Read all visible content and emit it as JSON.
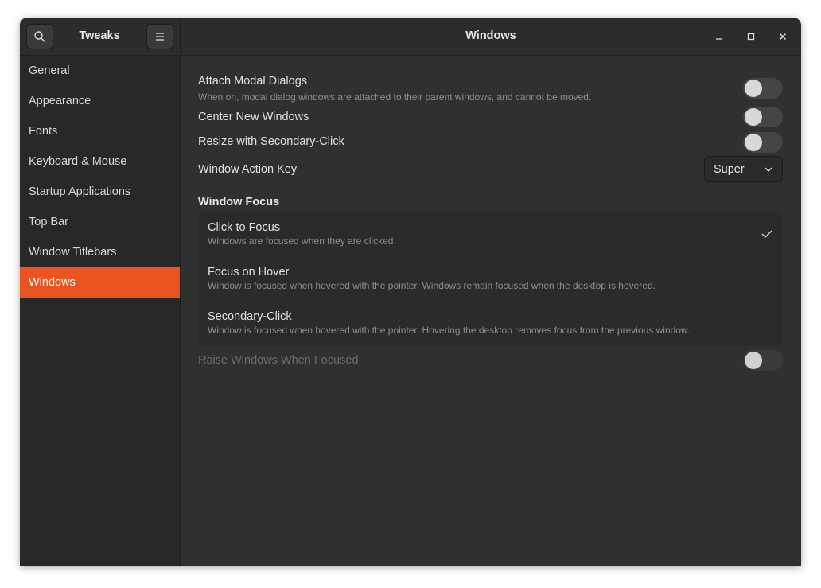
{
  "sidebar": {
    "title": "Tweaks",
    "search_icon": "search-icon",
    "menu_icon": "hamburger-menu-icon",
    "items": [
      {
        "label": "General",
        "active": false
      },
      {
        "label": "Appearance",
        "active": false
      },
      {
        "label": "Fonts",
        "active": false
      },
      {
        "label": "Keyboard & Mouse",
        "active": false
      },
      {
        "label": "Startup Applications",
        "active": false
      },
      {
        "label": "Top Bar",
        "active": false
      },
      {
        "label": "Window Titlebars",
        "active": false
      },
      {
        "label": "Windows",
        "active": true
      }
    ]
  },
  "header": {
    "title": "Windows",
    "controls": [
      "minimize-icon",
      "maximize-icon",
      "close-icon"
    ]
  },
  "settings": {
    "attach_modal": {
      "label": "Attach Modal Dialogs",
      "description": "When on, modal dialog windows are attached to their parent windows, and cannot be moved.",
      "enabled": false
    },
    "center_new": {
      "label": "Center New Windows",
      "enabled": false
    },
    "resize_secondary": {
      "label": "Resize with Secondary-Click",
      "enabled": false
    },
    "action_key": {
      "label": "Window Action Key",
      "value": "Super"
    }
  },
  "window_focus": {
    "title": "Window Focus",
    "options": [
      {
        "title": "Click to Focus",
        "description": "Windows are focused when they are clicked.",
        "selected": true
      },
      {
        "title": "Focus on Hover",
        "description": "Window is focused when hovered with the pointer. Windows remain focused when the desktop is hovered.",
        "selected": false
      },
      {
        "title": "Secondary-Click",
        "description": "Window is focused when hovered with the pointer. Hovering the desktop removes focus from the previous window.",
        "selected": false
      }
    ],
    "raise": {
      "label": "Raise Windows When Focused",
      "enabled": false,
      "disabled": true
    }
  },
  "colors": {
    "accent": "#e95420",
    "window_bg": "#303030",
    "sidebar_bg": "#282828"
  }
}
